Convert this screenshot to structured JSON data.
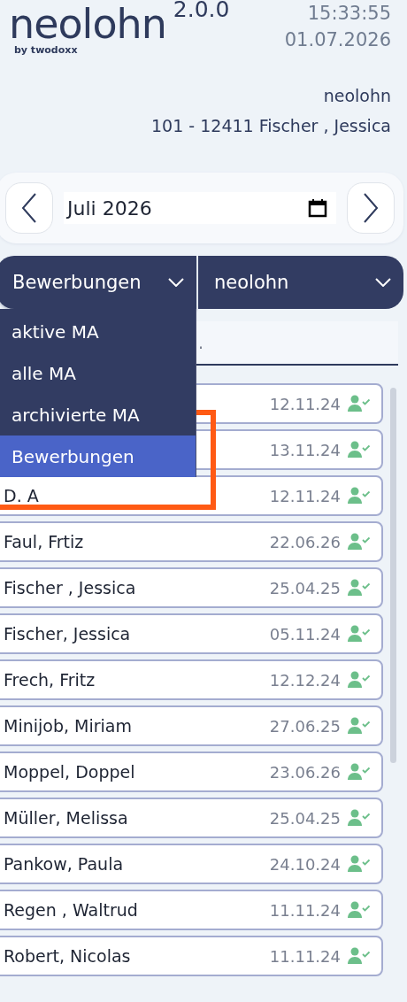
{
  "header": {
    "logo": "neolohn",
    "byline": "by twodoxx",
    "version": "2.0.0",
    "time": "15:33:55",
    "date": "01.07.2026",
    "company": "neolohn",
    "employee": "101 - 12411 Fischer , Jessica"
  },
  "month_picker": {
    "value": "Juli 2026"
  },
  "filters": [
    {
      "value": "Bewerbungen",
      "expanded": true
    },
    {
      "value": "neolohn",
      "expanded": false
    }
  ],
  "filter_menu": [
    {
      "label": "aktive MA",
      "selected": false
    },
    {
      "label": "alle MA",
      "selected": false
    },
    {
      "label": "archivierte MA",
      "selected": false
    },
    {
      "label": "Bewerbungen",
      "selected": true
    }
  ],
  "search": {
    "placeholder": "."
  },
  "employees": [
    {
      "date": "12.11.24"
    },
    {
      "date": "13.11.24"
    },
    {
      "name": "D. A",
      "date": "12.11.24"
    },
    {
      "name": "Faul, Frtiz",
      "date": "22.06.26"
    },
    {
      "name": "Fischer , Jessica",
      "date": "25.04.25"
    },
    {
      "name": "Fischer, Jessica",
      "date": "05.11.24"
    },
    {
      "name": "Frech, Fritz",
      "date": "12.12.24"
    },
    {
      "name": "Minijob, Miriam",
      "date": "27.06.25"
    },
    {
      "name": "Moppel, Doppel",
      "date": "23.06.26"
    },
    {
      "name": "Müller, Melissa",
      "date": "25.04.25"
    },
    {
      "name": "Pankow, Paula",
      "date": "24.10.24"
    },
    {
      "name": "Regen , Waltrud",
      "date": "11.11.24"
    },
    {
      "name": "Robert, Nicolas",
      "date": "11.11.24"
    }
  ]
}
